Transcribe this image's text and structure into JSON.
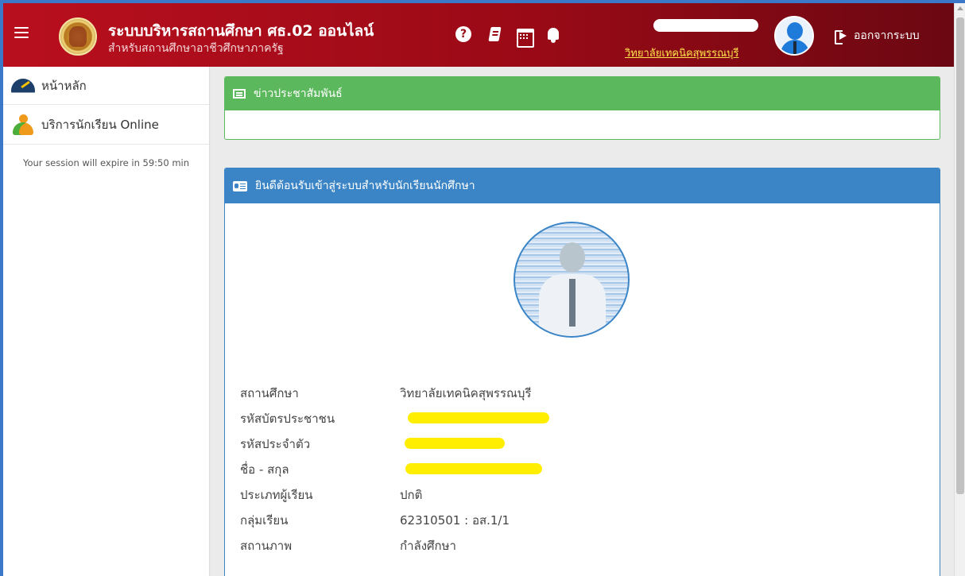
{
  "header": {
    "app_title": "ระบบบริหารสถานศึกษา ศธ.02 ออนไลน์",
    "app_subtitle": "สำหรับสถานศึกษาอาชีวศึกษาภาครัฐ",
    "user_college": "วิทยาลัยเทคนิคสุพรรณบุรี",
    "logout_label": "ออกจากระบบ",
    "icons": [
      "menu-icon",
      "help-icon",
      "book-icon",
      "calendar-icon",
      "bell-icon",
      "user-avatar",
      "logout-icon"
    ],
    "gradient_colors": [
      "#b90f1e",
      "#6b0812"
    ]
  },
  "sidebar": {
    "items": [
      {
        "label": "หน้าหลัก",
        "icon": "dashboard-gauge-icon"
      },
      {
        "label": "บริการนักเรียน Online",
        "icon": "students-icon"
      }
    ],
    "session_text": "Your session will expire in 59:50 min"
  },
  "news_panel": {
    "title": "ข่าวประชาสัมพันธ์",
    "color": "#5cb85c"
  },
  "welcome_panel": {
    "title": "ยินดีต้อนรับเข้าสู่ระบบสำหรับนักเรียนนักศึกษา",
    "color": "#3b85c7",
    "fields": [
      {
        "label": "สถานศึกษา",
        "value": "วิทยาลัยเทคนิคสุพรรณบุรี"
      },
      {
        "label": "รหัสบัตรประชาชน",
        "value": ""
      },
      {
        "label": "รหัสประจำตัว",
        "value": ""
      },
      {
        "label": "ชื่อ - สกุล",
        "value": ""
      },
      {
        "label": "ประเภทผู้เรียน",
        "value": "ปกติ"
      },
      {
        "label": "กลุ่มเรียน",
        "value": "62310501 : อส.1/1"
      },
      {
        "label": "สถานภาพ",
        "value": "กำลังศึกษา"
      }
    ]
  }
}
